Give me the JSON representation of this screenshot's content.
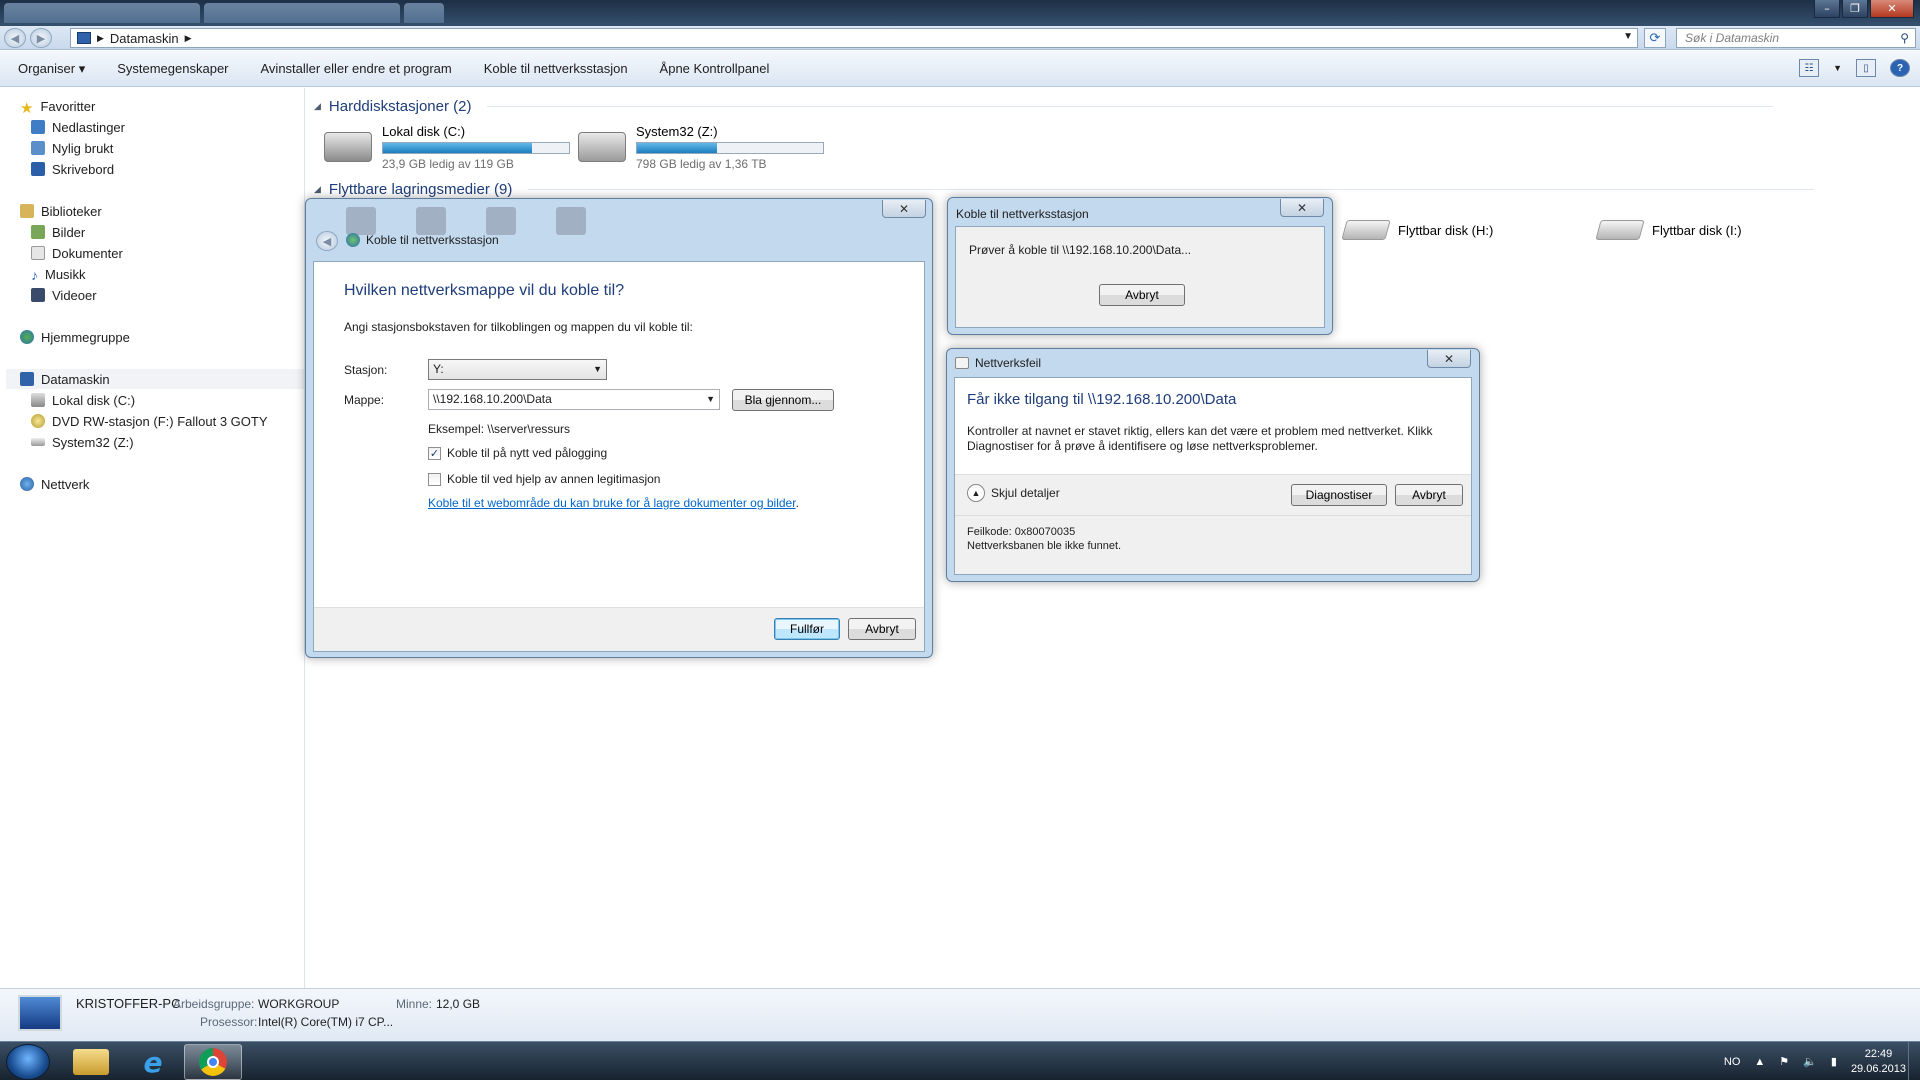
{
  "window": {
    "minimize": "–",
    "maximize": "❐",
    "close": "✕"
  },
  "address": {
    "path": "Datamaskin",
    "search_placeholder": "Søk i Datamaskin"
  },
  "toolbar": {
    "organize": "Organiser ▾",
    "system_properties": "Systemegenskaper",
    "uninstall": "Avinstaller eller endre et program",
    "map_drive": "Koble til nettverksstasjon",
    "control_panel": "Åpne Kontrollpanel"
  },
  "nav": {
    "favorites": "Favoritter",
    "downloads": "Nedlastinger",
    "recent": "Nylig brukt",
    "desktop": "Skrivebord",
    "libraries": "Biblioteker",
    "pictures": "Bilder",
    "documents": "Dokumenter",
    "music": "Musikk",
    "videos": "Videoer",
    "homegroup": "Hjemmegruppe",
    "computer": "Datamaskin",
    "local_disk": "Lokal disk (C:)",
    "dvd": "DVD RW-stasjon (F:) Fallout 3 GOTY",
    "system32": "System32 (Z:)",
    "network": "Nettverk"
  },
  "content": {
    "hdd_header": "Harddiskstasjoner (2)",
    "removable_header": "Flyttbare lagringsmedier (9)",
    "drives": [
      {
        "name": "Lokal disk (C:)",
        "free": "23,9 GB ledig av 119 GB",
        "used_fraction": 0.8
      },
      {
        "name": "System32 (Z:)",
        "free": "798 GB ledig av 1,36 TB",
        "used_fraction": 0.43
      }
    ],
    "removable": [
      {
        "name": "Flyttbar disk (H:)"
      },
      {
        "name": "Flyttbar disk (I:)"
      }
    ]
  },
  "details": {
    "computer_name": "KRISTOFFER-PC",
    "workgroup_label": "Arbeidsgruppe:",
    "workgroup": "WORKGROUP",
    "memory_label": "Minne:",
    "memory": "12,0 GB",
    "processor_label": "Prosessor:",
    "processor": "Intel(R) Core(TM) i7 CP..."
  },
  "taskbar": {
    "language": "NO",
    "time": "22:49",
    "date": "29.06.2013"
  },
  "map_dialog": {
    "title": "Koble til nettverksstasjon",
    "heading": "Hvilken nettverksmappe vil du koble til?",
    "instruction": "Angi stasjonsbokstaven for tilkoblingen og mappen du vil koble til:",
    "drive_label": "Stasjon:",
    "drive_value": "Y:",
    "folder_label": "Mappe:",
    "folder_value": "\\\\192.168.10.200\\Data",
    "browse": "Bla gjennom...",
    "example": "Eksempel: \\\\server\\ressurs",
    "reconnect": "Koble til på nytt ved pålogging",
    "reconnect_checked": true,
    "other_credentials": "Koble til ved hjelp av annen legitimasjon",
    "other_credentials_checked": false,
    "web_link": "Koble til et webområde du kan bruke for å lagre dokumenter og bilder",
    "finish": "Fullfør",
    "cancel": "Avbryt"
  },
  "progress_dialog": {
    "title": "Koble til nettverksstasjon",
    "message": "Prøver å koble til \\\\192.168.10.200\\Data...",
    "cancel": "Avbryt"
  },
  "error_dialog": {
    "title": "Nettverksfeil",
    "heading": "Får ikke tilgang til \\\\192.168.10.200\\Data",
    "message": "Kontroller at navnet er stavet riktig, ellers kan det være et problem med nettverket. Klikk Diagnostiser for å prøve å identifisere og løse nettverksproblemer.",
    "hide_details": "Skjul detaljer",
    "diagnose": "Diagnostiser",
    "cancel": "Avbryt",
    "error_code": "Feilkode: 0x80070035",
    "error_text": "Nettverksbanen ble ikke funnet."
  }
}
